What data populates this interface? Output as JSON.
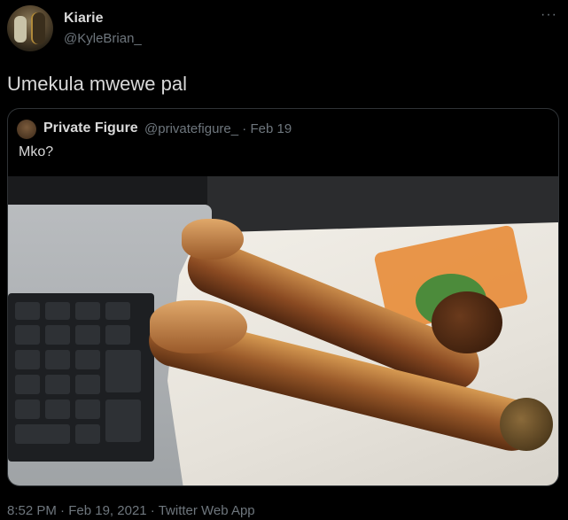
{
  "tweet": {
    "author": {
      "display_name": "Kiarie",
      "handle": "@KyleBrian_"
    },
    "more_icon": "more-horizontal-icon",
    "text": "Umekula mwewe pal",
    "footer": {
      "time": "8:52 PM",
      "date": "Feb 19, 2021",
      "source": "Twitter Web App",
      "separator": "·"
    }
  },
  "quoted_tweet": {
    "author": {
      "display_name": "Private Figure",
      "handle": "@privatefigure_"
    },
    "separator": "·",
    "date": "Feb 19",
    "text": "Mko?"
  },
  "colors": {
    "background": "#000000",
    "text": "#d9d9d9",
    "secondary": "#6e767d",
    "border": "#2f3336"
  }
}
